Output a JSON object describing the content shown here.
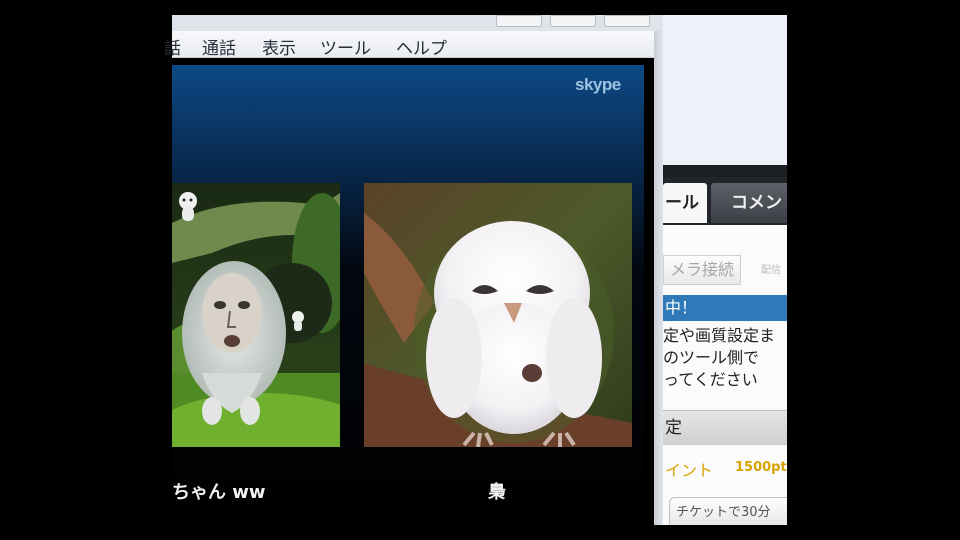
{
  "menu": {
    "items": [
      {
        "label": "話",
        "key": "partial"
      },
      {
        "label": "通話",
        "key": "call"
      },
      {
        "label": "表示",
        "key": "view"
      },
      {
        "label": "ツール",
        "key": "tools"
      },
      {
        "label": "ヘルプ",
        "key": "help"
      }
    ]
  },
  "video": {
    "brand": "skype",
    "participants": [
      {
        "caption": "ちゃん ww"
      },
      {
        "caption": "梟"
      }
    ]
  },
  "side_panel": {
    "tabs": [
      {
        "label": "ール",
        "active": true
      },
      {
        "label": "コメン",
        "active": false
      }
    ],
    "step_label": "メラ接続",
    "step_next": "配信",
    "status": "中！",
    "notice_lines": [
      "定や画質設定ま",
      "のツール側で",
      "ってください"
    ],
    "settings_header": "定",
    "points_label": "イント",
    "points_value": "1500pt",
    "ticket_label": "チケットで30分"
  },
  "colors": {
    "status_bar": "#2f79b8",
    "points": "#d9a500",
    "video_top": "#0d4a86"
  }
}
